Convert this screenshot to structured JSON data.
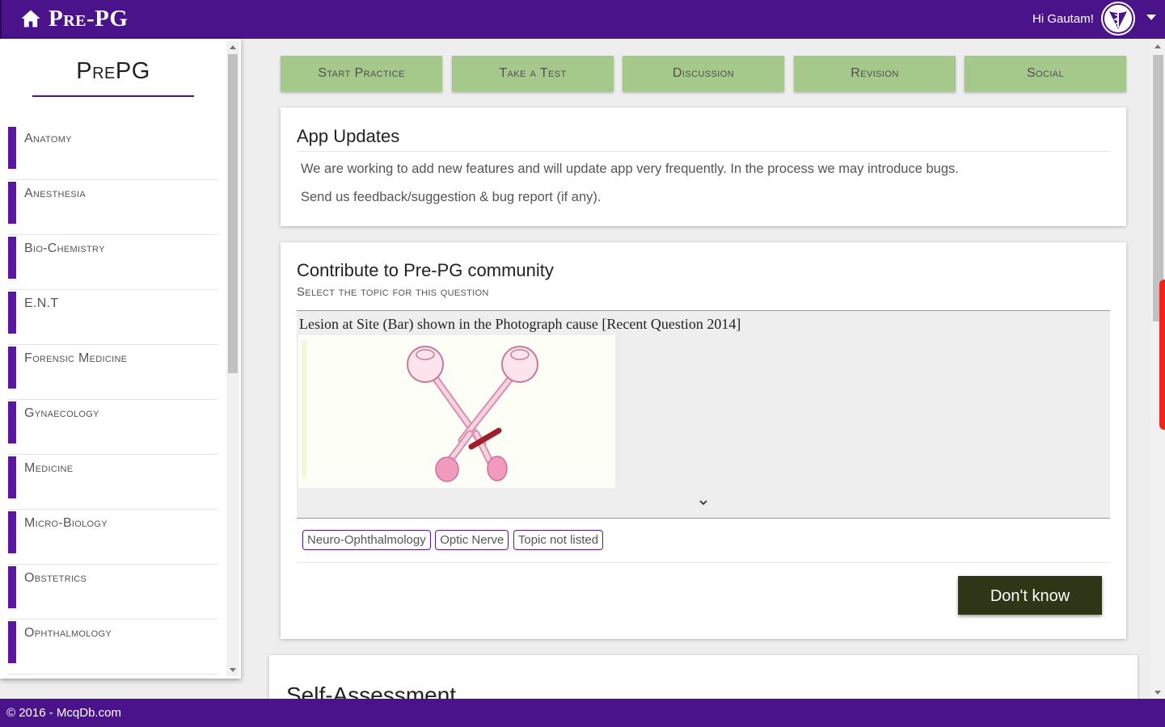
{
  "header": {
    "brand": "Pre-PG",
    "greeting": "Hi Gautam!",
    "colors": {
      "bar": "#4a138a"
    }
  },
  "sidebar": {
    "title": "PrePG",
    "items": [
      {
        "label": "Anatomy"
      },
      {
        "label": "Anesthesia"
      },
      {
        "label": "Bio-Chemistry"
      },
      {
        "label": "E.N.T"
      },
      {
        "label": "Forensic Medicine"
      },
      {
        "label": "Gynaecology"
      },
      {
        "label": "Medicine"
      },
      {
        "label": "Micro-Biology"
      },
      {
        "label": "Obstetrics"
      },
      {
        "label": "Ophthalmology"
      }
    ]
  },
  "tabs": [
    {
      "label": "Start Practice"
    },
    {
      "label": "Take a Test"
    },
    {
      "label": "Discussion"
    },
    {
      "label": "Revision"
    },
    {
      "label": "Social"
    }
  ],
  "updates": {
    "title": "App Updates",
    "line1": "We are working to add new features and will update app very frequently. In the process we may introduce bugs.",
    "line2": "Send us feedback/suggestion & bug report (if any)."
  },
  "contribute": {
    "title": "Contribute to Pre-PG community",
    "subtitle": "Select the topic for this question",
    "question": "Lesion at Site (Bar) shown in the Photograph cause [Recent Question 2014]",
    "chips": [
      "Neuro-Ophthalmology",
      "Optic Nerve",
      "Topic not listed"
    ],
    "dont_know": "Don't know"
  },
  "self_assessment": {
    "title": "Self-Assessment"
  },
  "footer": {
    "text": "© 2016 - McqDb.com"
  }
}
